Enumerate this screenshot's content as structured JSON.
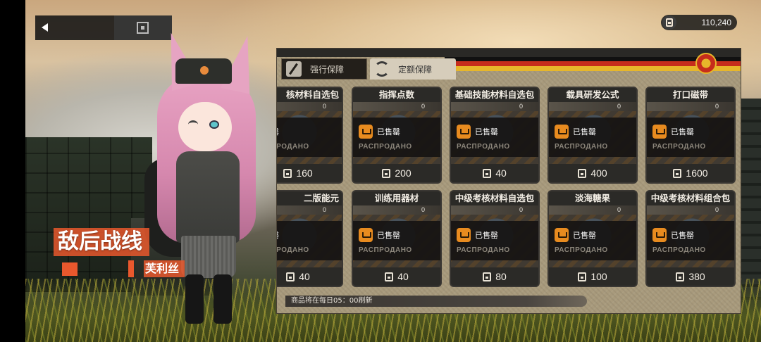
{
  "currency": {
    "icon": "supply-token-icon",
    "value": "110,240"
  },
  "event": {
    "title": "敌后战线",
    "character_name": "芙利丝"
  },
  "tabs": [
    {
      "label": "强行保障",
      "icon": "slash-icon",
      "active": false
    },
    {
      "label": "定额保障",
      "icon": "refresh-icon",
      "active": true
    }
  ],
  "colors": {
    "accent": "#e9582d",
    "sold_cart": "#e88b1f",
    "flag_red": "#c62d1c",
    "flag_gold": "#e7b72a"
  },
  "items": [
    {
      "name": "核材料自选包",
      "count": "0",
      "sold_label": "已售罄",
      "sold_label_ru": "РАСПРОДАНО",
      "price": "160"
    },
    {
      "name": "指挥点数",
      "count": "0",
      "sold_label": "已售罄",
      "sold_label_ru": "РАСПРОДАНО",
      "price": "200"
    },
    {
      "name": "基础技能材料自选包",
      "count": "0",
      "sold_label": "已售罄",
      "sold_label_ru": "РАСПРОДАНО",
      "price": "40"
    },
    {
      "name": "载具研发公式",
      "count": "0",
      "sold_label": "已售罄",
      "sold_label_ru": "РАСПРОДАНО",
      "price": "400"
    },
    {
      "name": "打口磁带",
      "count": "0",
      "sold_label": "已售罄",
      "sold_label_ru": "РАСПРОДАНО",
      "price": "1600"
    },
    {
      "name": "二版能元",
      "count": "0",
      "sold_label": "已售罄",
      "sold_label_ru": "РАСПРОДАНО",
      "price": "40"
    },
    {
      "name": "训练用器材",
      "count": "0",
      "sold_label": "已售罄",
      "sold_label_ru": "РАСПРОДАНО",
      "price": "40"
    },
    {
      "name": "中级考核材料自选包",
      "count": "0",
      "sold_label": "已售罄",
      "sold_label_ru": "РАСПРОДАНО",
      "price": "80"
    },
    {
      "name": "淡海糖果",
      "count": "0",
      "sold_label": "已售罄",
      "sold_label_ru": "РАСПРОДАНО",
      "price": "100"
    },
    {
      "name": "中级考核材料组合包",
      "count": "0",
      "sold_label": "已售罄",
      "sold_label_ru": "РАСПРОДАНО",
      "price": "380"
    }
  ],
  "footer": {
    "refresh_note": "商品将在每日05：00刷新"
  }
}
